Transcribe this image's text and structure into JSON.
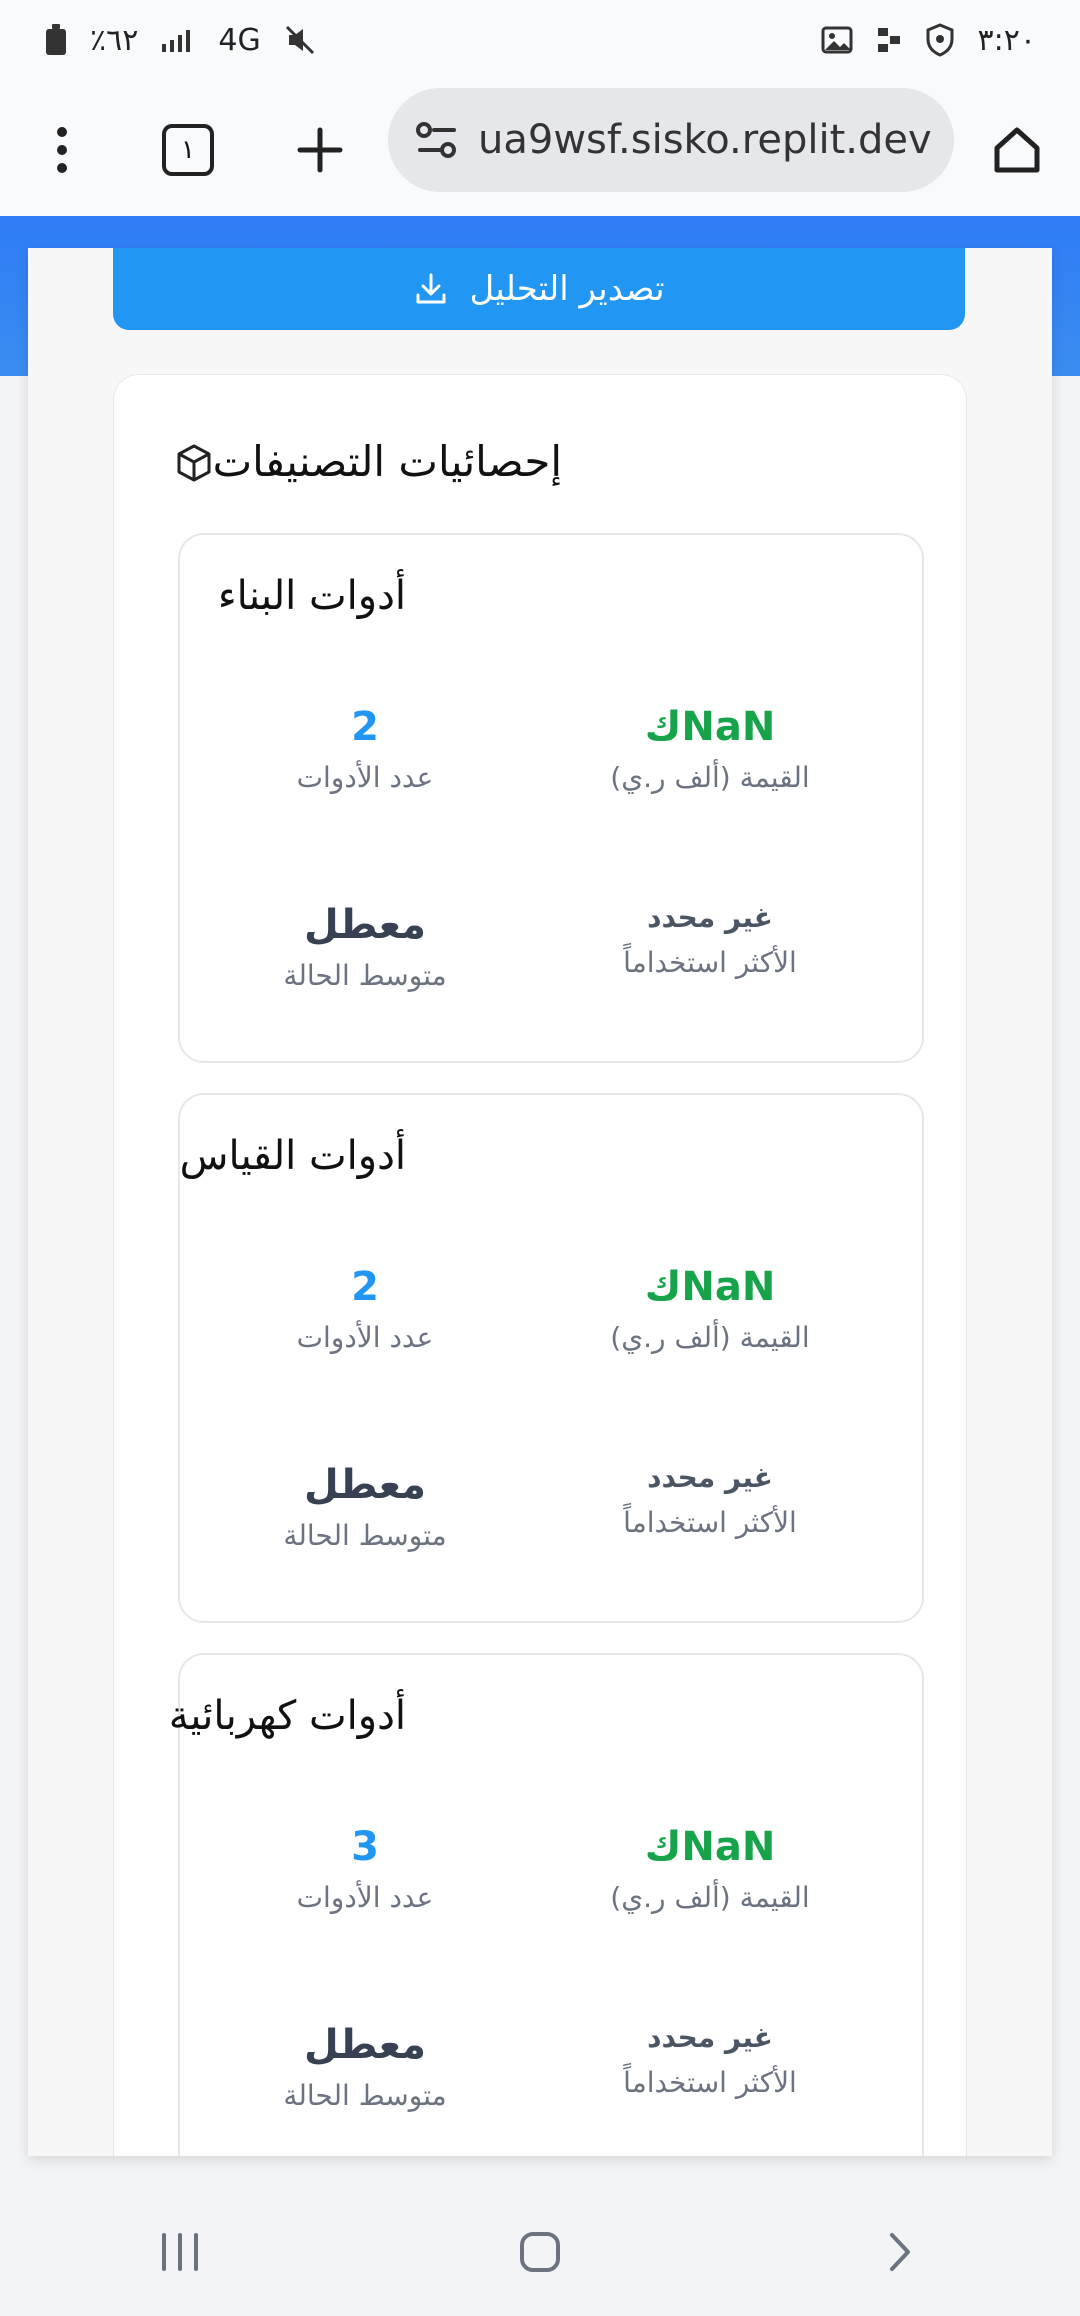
{
  "status_bar": {
    "battery": "٪٦٢",
    "network": "4G",
    "time": "٣:٢٠"
  },
  "browser": {
    "url": "ua9wsf.sisko.replit.dev",
    "tab_count": "١"
  },
  "export_button": {
    "label": "تصدير التحليل"
  },
  "stats": {
    "title": "إحصائيات التصنيفات",
    "categories": [
      {
        "name": "أدوات البناء",
        "value_label": "القيمة (ألف ر.ي)",
        "value": "NaNك",
        "count_label": "عدد الأدوات",
        "count": "2",
        "most_used_label": "الأكثر استخداماً",
        "most_used": "غير محدد",
        "avg_status_label": "متوسط الحالة",
        "avg_status": "معطل"
      },
      {
        "name": "أدوات القياس",
        "value_label": "القيمة (ألف ر.ي)",
        "value": "NaNك",
        "count_label": "عدد الأدوات",
        "count": "2",
        "most_used_label": "الأكثر استخداماً",
        "most_used": "غير محدد",
        "avg_status_label": "متوسط الحالة",
        "avg_status": "معطل"
      },
      {
        "name": "أدوات كهربائية",
        "value_label": "القيمة (ألف ر.ي)",
        "value": "NaNك",
        "count_label": "عدد الأدوات",
        "count": "3",
        "most_used_label": "الأكثر استخداماً",
        "most_used": "غير محدد",
        "avg_status_label": "متوسط الحالة",
        "avg_status": "معطل"
      }
    ]
  },
  "icons": {
    "battery": "battery-icon",
    "signal": "signal-icon",
    "mute": "mute-icon",
    "gallery": "gallery-icon",
    "shield": "shield-icon",
    "menu": "menu-icon",
    "tabs": "tabs-icon",
    "add": "add-icon",
    "home": "home-icon",
    "download": "download-icon",
    "cube": "cube-icon",
    "recent_apps": "recent-apps-icon",
    "home_nav": "home-nav-icon",
    "back": "back-icon"
  },
  "colors": {
    "accent": "#2196f3",
    "value_green": "#16a34a",
    "muted": "#6b7280"
  }
}
